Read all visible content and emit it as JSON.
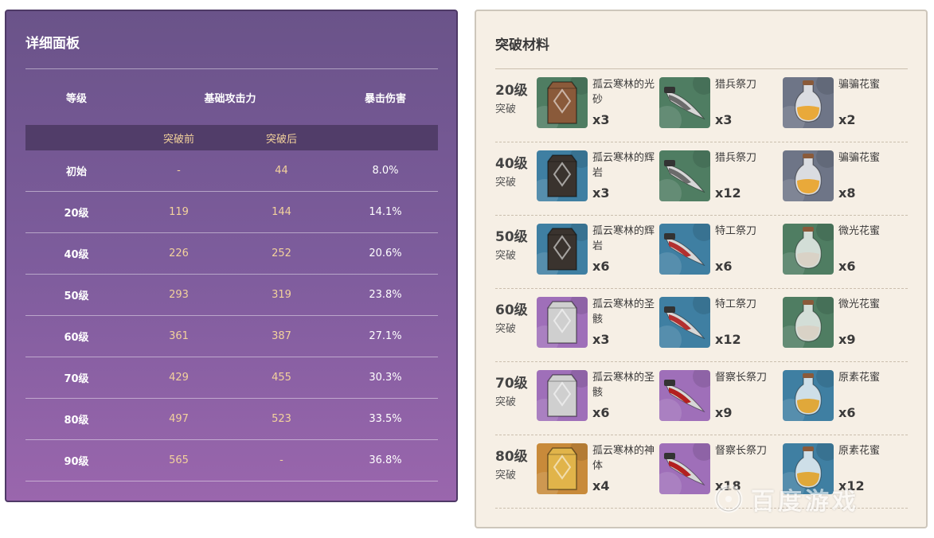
{
  "left": {
    "title": "详细面板",
    "headers": {
      "level": "等级",
      "atk": "基础攻击力",
      "crit": "暴击伤害"
    },
    "subheaders": {
      "before": "突破前",
      "after": "突破后"
    },
    "rows": [
      {
        "level": "初始",
        "before": "-",
        "after": "44",
        "crit": "8.0%"
      },
      {
        "level": "20级",
        "before": "119",
        "after": "144",
        "crit": "14.1%"
      },
      {
        "level": "40级",
        "before": "226",
        "after": "252",
        "crit": "20.6%"
      },
      {
        "level": "50级",
        "before": "293",
        "after": "319",
        "crit": "23.8%"
      },
      {
        "level": "60级",
        "before": "361",
        "after": "387",
        "crit": "27.1%"
      },
      {
        "level": "70级",
        "before": "429",
        "after": "455",
        "crit": "30.3%"
      },
      {
        "level": "80级",
        "before": "497",
        "after": "523",
        "crit": "33.5%"
      },
      {
        "level": "90级",
        "before": "565",
        "after": "-",
        "crit": "36.8%"
      }
    ]
  },
  "right": {
    "title": "突破材料",
    "type_label": "突破",
    "rows": [
      {
        "level": "20级",
        "items": [
          {
            "name": "孤云寒林的光砂",
            "qty": "x3",
            "icon": "stone-sliver-icon",
            "bg": "#4f7d62",
            "tone": "#8a5a3a"
          },
          {
            "name": "猎兵祭刀",
            "qty": "x3",
            "icon": "blade-icon",
            "bg": "#4f7d62",
            "tone": "#6b6b6b"
          },
          {
            "name": "骗骗花蜜",
            "qty": "x2",
            "icon": "nectar-bottle-icon",
            "bg": "#6e7587",
            "tone": "#e9a93a"
          }
        ]
      },
      {
        "level": "40级",
        "items": [
          {
            "name": "孤云寒林的辉岩",
            "qty": "x3",
            "icon": "stone-fragment-icon",
            "bg": "#3f7fa2",
            "tone": "#3a332e"
          },
          {
            "name": "猎兵祭刀",
            "qty": "x12",
            "icon": "blade-icon",
            "bg": "#4f7d62",
            "tone": "#6b6b6b"
          },
          {
            "name": "骗骗花蜜",
            "qty": "x8",
            "icon": "nectar-bottle-icon",
            "bg": "#6e7587",
            "tone": "#e9a93a"
          }
        ]
      },
      {
        "level": "50级",
        "items": [
          {
            "name": "孤云寒林的辉岩",
            "qty": "x6",
            "icon": "stone-fragment-icon",
            "bg": "#3f7fa2",
            "tone": "#3a332e"
          },
          {
            "name": "特工祭刀",
            "qty": "x6",
            "icon": "blade-icon",
            "bg": "#3f7fa2",
            "tone": "#b33030"
          },
          {
            "name": "微光花蜜",
            "qty": "x6",
            "icon": "nectar-vial-icon",
            "bg": "#4f7d62",
            "tone": "#d9d2c6"
          }
        ]
      },
      {
        "level": "60级",
        "items": [
          {
            "name": "孤云寒林的圣骸",
            "qty": "x3",
            "icon": "stone-chunk-icon",
            "bg": "#9f6fb9",
            "tone": "#cfcfcf"
          },
          {
            "name": "特工祭刀",
            "qty": "x12",
            "icon": "blade-icon",
            "bg": "#3f7fa2",
            "tone": "#b33030"
          },
          {
            "name": "微光花蜜",
            "qty": "x9",
            "icon": "nectar-vial-icon",
            "bg": "#4f7d62",
            "tone": "#d9d2c6"
          }
        ]
      },
      {
        "level": "70级",
        "items": [
          {
            "name": "孤云寒林的圣骸",
            "qty": "x6",
            "icon": "stone-chunk-icon",
            "bg": "#9f6fb9",
            "tone": "#cfcfcf"
          },
          {
            "name": "督察长祭刀",
            "qty": "x9",
            "icon": "blade-icon",
            "bg": "#9f6fb9",
            "tone": "#b32020"
          },
          {
            "name": "原素花蜜",
            "qty": "x6",
            "icon": "nectar-urn-icon",
            "bg": "#3f7fa2",
            "tone": "#e0a83a"
          }
        ]
      },
      {
        "level": "80级",
        "items": [
          {
            "name": "孤云寒林的神体",
            "qty": "x4",
            "icon": "stone-gemstone-icon",
            "bg": "#c88a3a",
            "tone": "#e1b44a"
          },
          {
            "name": "督察长祭刀",
            "qty": "x18",
            "icon": "blade-icon",
            "bg": "#9f6fb9",
            "tone": "#b32020"
          },
          {
            "name": "原素花蜜",
            "qty": "x12",
            "icon": "nectar-urn-icon",
            "bg": "#3f7fa2",
            "tone": "#e0a83a"
          }
        ]
      }
    ]
  },
  "watermark": {
    "text": "百度游戏"
  }
}
